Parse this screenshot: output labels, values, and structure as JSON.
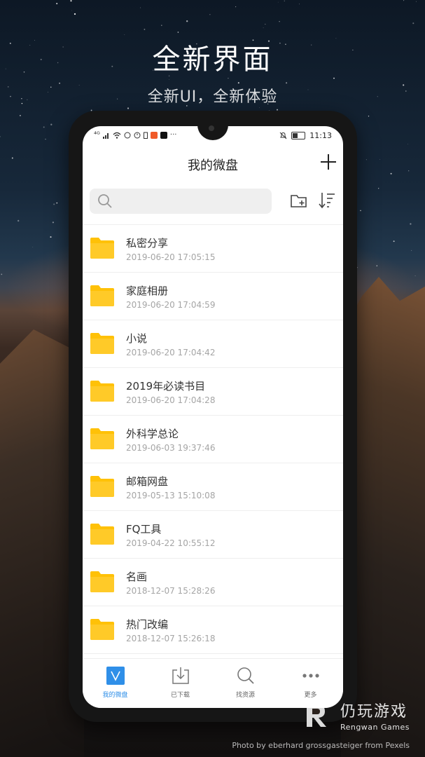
{
  "promo": {
    "headline": "全新界面",
    "subline": "全新UI，全新体验"
  },
  "statusbar": {
    "signal_text": "⁴ᴳ",
    "time": "11:13",
    "more": "···"
  },
  "header": {
    "title": "我的微盘"
  },
  "search": {
    "placeholder": ""
  },
  "files": [
    {
      "name": "私密分享",
      "date": "2019-06-20 17:05:15"
    },
    {
      "name": "家庭相册",
      "date": "2019-06-20 17:04:59"
    },
    {
      "name": "小说",
      "date": "2019-06-20 17:04:42"
    },
    {
      "name": "2019年必读书目",
      "date": "2019-06-20 17:04:28"
    },
    {
      "name": "外科学总论",
      "date": "2019-06-03 19:37:46"
    },
    {
      "name": "邮箱网盘",
      "date": "2019-05-13 15:10:08"
    },
    {
      "name": "FQ工具",
      "date": "2019-04-22 10:55:12"
    },
    {
      "name": "名画",
      "date": "2018-12-07 15:28:26"
    },
    {
      "name": "热门改编",
      "date": "2018-12-07 15:26:18"
    },
    {
      "name": "",
      "date": ""
    }
  ],
  "tabs": [
    {
      "label": "我的微盘",
      "icon": "v-disk-icon",
      "active": true
    },
    {
      "label": "已下载",
      "icon": "download-icon",
      "active": false
    },
    {
      "label": "找资源",
      "icon": "search-icon",
      "active": false
    },
    {
      "label": "更多",
      "icon": "more-dots-icon",
      "active": false
    }
  ],
  "watermark": {
    "cn": "仍玩游戏",
    "en": "Rengwan Games",
    "credit": "Photo by eberhard grossgasteiger from Pexels"
  },
  "colors": {
    "folder": "#ffc107",
    "accent": "#2f8fe8",
    "date_text": "#a5a5a5"
  }
}
